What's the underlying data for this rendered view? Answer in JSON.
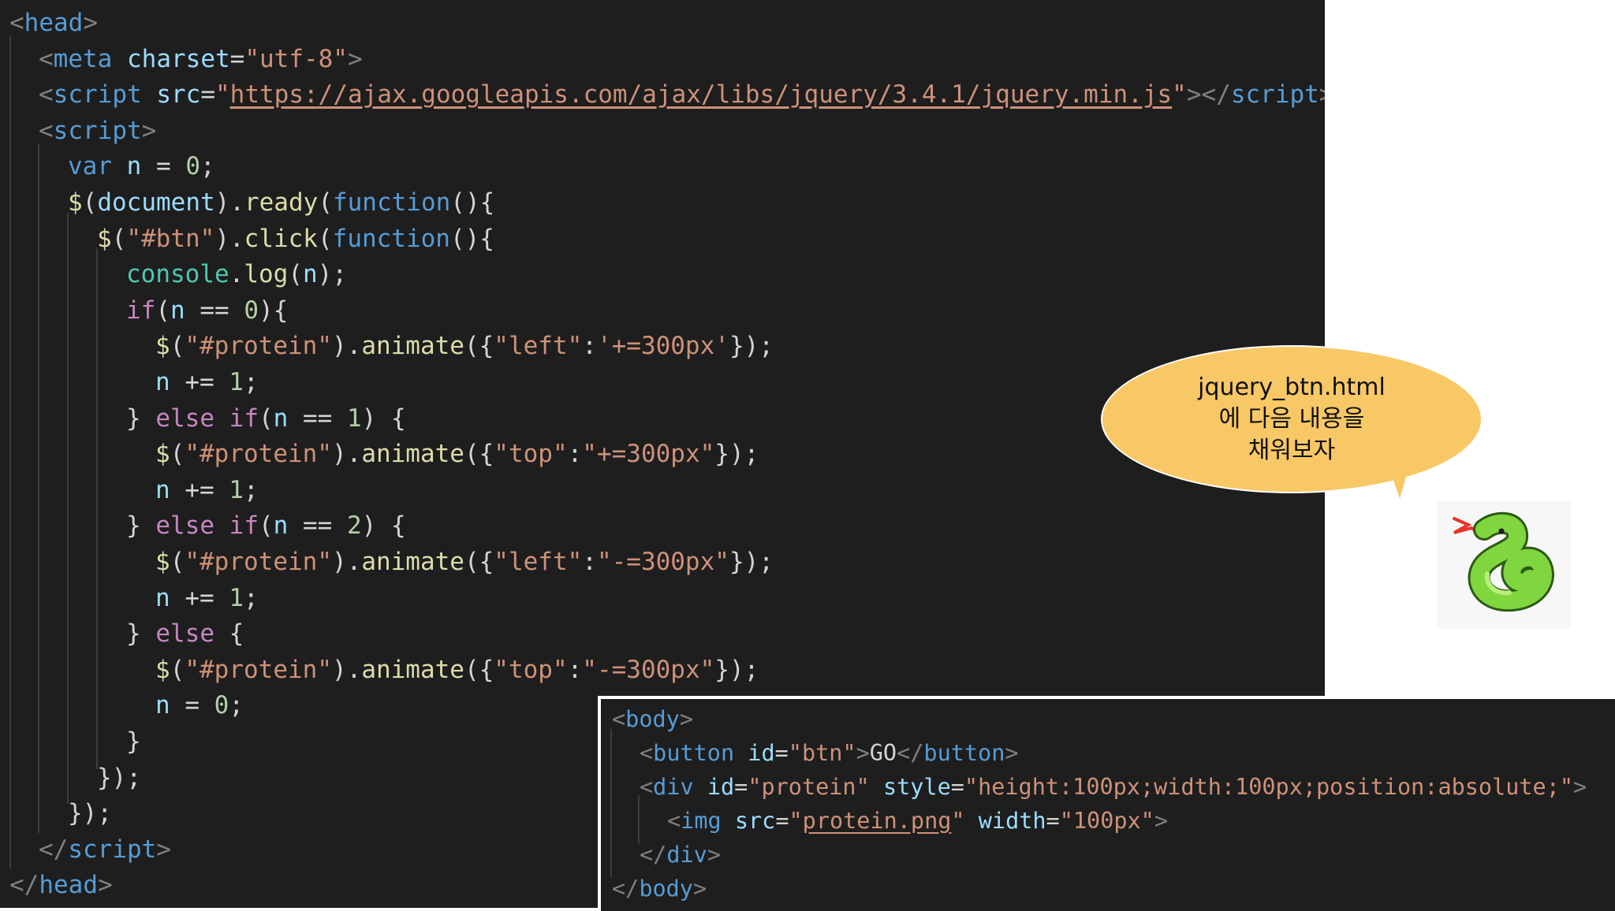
{
  "head_code": {
    "lines": [
      [
        [
          "punc",
          "<"
        ],
        [
          "tag",
          "head"
        ],
        [
          "punc",
          ">"
        ]
      ],
      [
        [
          "punc",
          "<"
        ],
        [
          "tag",
          "meta"
        ],
        [
          "op",
          " "
        ],
        [
          "attr",
          "charset"
        ],
        [
          "op",
          "="
        ],
        [
          "str",
          "\"utf-8\""
        ],
        [
          "punc",
          ">"
        ]
      ],
      [
        [
          "punc",
          "<"
        ],
        [
          "tag",
          "script"
        ],
        [
          "op",
          " "
        ],
        [
          "attr",
          "src"
        ],
        [
          "op",
          "="
        ],
        [
          "str",
          "\""
        ],
        [
          "url",
          "https://ajax.googleapis.com/ajax/libs/jquery/3.4.1/jquery.min.js"
        ],
        [
          "str",
          "\""
        ],
        [
          "punc",
          "></"
        ],
        [
          "tag",
          "script"
        ],
        [
          "punc",
          ">"
        ]
      ],
      [
        [
          "punc",
          "<"
        ],
        [
          "tag",
          "script"
        ],
        [
          "punc",
          ">"
        ]
      ],
      [
        [
          "kw",
          "var"
        ],
        [
          "op",
          " "
        ],
        [
          "var",
          "n"
        ],
        [
          "op",
          " = "
        ],
        [
          "num",
          "0"
        ],
        [
          "op",
          ";"
        ]
      ],
      [
        [
          "fn",
          "$"
        ],
        [
          "op",
          "("
        ],
        [
          "var",
          "document"
        ],
        [
          "op",
          ")."
        ],
        [
          "fn",
          "ready"
        ],
        [
          "op",
          "("
        ],
        [
          "kw",
          "function"
        ],
        [
          "op",
          "(){"
        ]
      ],
      [
        [
          "fn",
          "$"
        ],
        [
          "op",
          "("
        ],
        [
          "str",
          "\"#btn\""
        ],
        [
          "op",
          ")."
        ],
        [
          "fn",
          "click"
        ],
        [
          "op",
          "("
        ],
        [
          "kw",
          "function"
        ],
        [
          "op",
          "(){"
        ]
      ],
      [
        [
          "obj",
          "console"
        ],
        [
          "op",
          "."
        ],
        [
          "fn",
          "log"
        ],
        [
          "op",
          "("
        ],
        [
          "var",
          "n"
        ],
        [
          "op",
          ");"
        ]
      ],
      [
        [
          "ctl",
          "if"
        ],
        [
          "op",
          "("
        ],
        [
          "var",
          "n"
        ],
        [
          "op",
          " == "
        ],
        [
          "num",
          "0"
        ],
        [
          "op",
          "){"
        ]
      ],
      [
        [
          "fn",
          "$"
        ],
        [
          "op",
          "("
        ],
        [
          "str",
          "\"#protein\""
        ],
        [
          "op",
          ")."
        ],
        [
          "fn",
          "animate"
        ],
        [
          "op",
          "({"
        ],
        [
          "str",
          "\"left\""
        ],
        [
          "op",
          ":"
        ],
        [
          "str",
          "'+=300px'"
        ],
        [
          "op",
          "});"
        ]
      ],
      [
        [
          "var",
          "n"
        ],
        [
          "op",
          " += "
        ],
        [
          "num",
          "1"
        ],
        [
          "op",
          ";"
        ]
      ],
      [
        [
          "op",
          "} "
        ],
        [
          "ctl",
          "else"
        ],
        [
          "op",
          " "
        ],
        [
          "ctl",
          "if"
        ],
        [
          "op",
          "("
        ],
        [
          "var",
          "n"
        ],
        [
          "op",
          " == "
        ],
        [
          "num",
          "1"
        ],
        [
          "op",
          ") {"
        ]
      ],
      [
        [
          "fn",
          "$"
        ],
        [
          "op",
          "("
        ],
        [
          "str",
          "\"#protein\""
        ],
        [
          "op",
          ")."
        ],
        [
          "fn",
          "animate"
        ],
        [
          "op",
          "({"
        ],
        [
          "str",
          "\"top\""
        ],
        [
          "op",
          ":"
        ],
        [
          "str",
          "\"+=300px\""
        ],
        [
          "op",
          "});"
        ]
      ],
      [
        [
          "var",
          "n"
        ],
        [
          "op",
          " += "
        ],
        [
          "num",
          "1"
        ],
        [
          "op",
          ";"
        ]
      ],
      [
        [
          "op",
          "} "
        ],
        [
          "ctl",
          "else"
        ],
        [
          "op",
          " "
        ],
        [
          "ctl",
          "if"
        ],
        [
          "op",
          "("
        ],
        [
          "var",
          "n"
        ],
        [
          "op",
          " == "
        ],
        [
          "num",
          "2"
        ],
        [
          "op",
          ") {"
        ]
      ],
      [
        [
          "fn",
          "$"
        ],
        [
          "op",
          "("
        ],
        [
          "str",
          "\"#protein\""
        ],
        [
          "op",
          ")."
        ],
        [
          "fn",
          "animate"
        ],
        [
          "op",
          "({"
        ],
        [
          "str",
          "\"left\""
        ],
        [
          "op",
          ":"
        ],
        [
          "str",
          "\"-=300px\""
        ],
        [
          "op",
          "});"
        ]
      ],
      [
        [
          "var",
          "n"
        ],
        [
          "op",
          " += "
        ],
        [
          "num",
          "1"
        ],
        [
          "op",
          ";"
        ]
      ],
      [
        [
          "op",
          "} "
        ],
        [
          "ctl",
          "else"
        ],
        [
          "op",
          " {"
        ]
      ],
      [
        [
          "fn",
          "$"
        ],
        [
          "op",
          "("
        ],
        [
          "str",
          "\"#protein\""
        ],
        [
          "op",
          ")."
        ],
        [
          "fn",
          "animate"
        ],
        [
          "op",
          "({"
        ],
        [
          "str",
          "\"top\""
        ],
        [
          "op",
          ":"
        ],
        [
          "str",
          "\"-=300px\""
        ],
        [
          "op",
          "});"
        ]
      ],
      [
        [
          "var",
          "n"
        ],
        [
          "op",
          " = "
        ],
        [
          "num",
          "0"
        ],
        [
          "op",
          ";"
        ]
      ],
      [
        [
          "op",
          "}"
        ]
      ],
      [
        [
          "op",
          "});"
        ]
      ],
      [
        [
          "op",
          "});"
        ]
      ],
      [
        [
          "punc",
          "</"
        ],
        [
          "tag",
          "script"
        ],
        [
          "punc",
          ">"
        ]
      ],
      [
        [
          "punc",
          "</"
        ],
        [
          "tag",
          "head"
        ],
        [
          "punc",
          ">"
        ]
      ]
    ]
  },
  "body_code": {
    "lines": [
      [
        [
          "punc",
          "<"
        ],
        [
          "tag",
          "body"
        ],
        [
          "punc",
          ">"
        ]
      ],
      [
        [
          "punc",
          "<"
        ],
        [
          "tag",
          "button"
        ],
        [
          "op",
          " "
        ],
        [
          "attr",
          "id"
        ],
        [
          "op",
          "="
        ],
        [
          "str",
          "\"btn\""
        ],
        [
          "punc",
          ">"
        ],
        [
          "op",
          "GO"
        ],
        [
          "punc",
          "</"
        ],
        [
          "tag",
          "button"
        ],
        [
          "punc",
          ">"
        ]
      ],
      [
        [
          "punc",
          "<"
        ],
        [
          "tag",
          "div"
        ],
        [
          "op",
          " "
        ],
        [
          "attr",
          "id"
        ],
        [
          "op",
          "="
        ],
        [
          "str",
          "\"protein\""
        ],
        [
          "op",
          " "
        ],
        [
          "attr",
          "style"
        ],
        [
          "op",
          "="
        ],
        [
          "str",
          "\"height:100px;width:100px;position:absolute;\""
        ],
        [
          "punc",
          ">"
        ]
      ],
      [
        [
          "punc",
          "<"
        ],
        [
          "tag",
          "img"
        ],
        [
          "op",
          " "
        ],
        [
          "attr",
          "src"
        ],
        [
          "op",
          "="
        ],
        [
          "str",
          "\""
        ],
        [
          "url",
          "protein.png"
        ],
        [
          "str",
          "\""
        ],
        [
          "op",
          " "
        ],
        [
          "attr",
          "width"
        ],
        [
          "op",
          "="
        ],
        [
          "str",
          "\"100px\""
        ],
        [
          "punc",
          ">"
        ]
      ],
      [
        [
          "punc",
          "</"
        ],
        [
          "tag",
          "div"
        ],
        [
          "punc",
          ">"
        ]
      ],
      [
        [
          "punc",
          "</"
        ],
        [
          "tag",
          "body"
        ],
        [
          "punc",
          ">"
        ]
      ]
    ]
  },
  "bubble": {
    "lines": [
      "jquery_btn.html",
      "에 다음 내용을",
      "채워보자"
    ],
    "color": "#f8c866"
  },
  "mascot": {
    "icon": "snake-icon"
  }
}
